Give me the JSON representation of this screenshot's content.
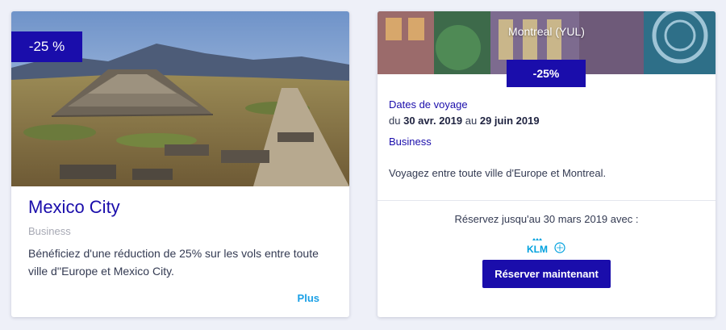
{
  "cards": [
    {
      "discount": "-25 %",
      "title": "Mexico City",
      "cabin": "Business",
      "description": "Bénéficiez d'une réduction de 25% sur les vols entre toute ville d''Europe et Mexico City.",
      "more_label": "Plus",
      "image_icon": "pyramid-photo"
    },
    {
      "image_caption": "Montreal (YUL)",
      "discount": "-25%",
      "dates_label": "Dates de voyage",
      "dates": {
        "from_word": "du",
        "start": "30 avr. 2019",
        "to_word": "au",
        "end": "29 juin 2019"
      },
      "cabin": "Business",
      "description": "Voyagez entre toute ville d'Europe et Montreal.",
      "book_by": "Réservez jusqu'au 30 mars 2019 avec :",
      "airline_logo": "KLM",
      "book_label": "Réserver maintenant",
      "image_icon": "montreal-photo"
    }
  ],
  "colors": {
    "accent": "#1a0dab",
    "link": "#1aa0e6",
    "muted": "#a7a9b4",
    "page_bg": "#eef0f8"
  }
}
